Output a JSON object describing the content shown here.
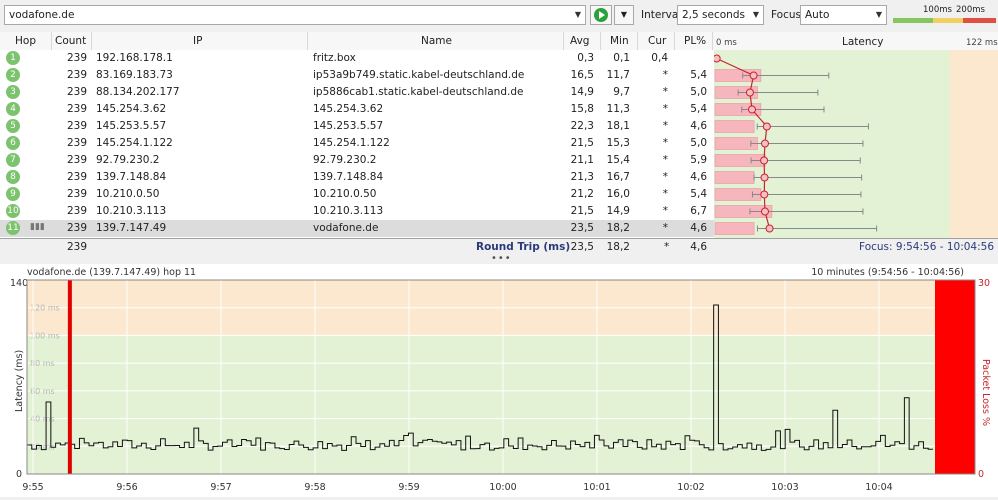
{
  "toolbar": {
    "target": "vodafone.de",
    "interval_label": "Interval",
    "interval_value": "2,5 seconds",
    "focus_label": "Focus",
    "focus_value": "Auto",
    "scale_labels": [
      "100ms",
      "200ms"
    ],
    "colors": {
      "green": "#86c65f",
      "yellow": "#f0d060",
      "red": "#e05040"
    }
  },
  "table": {
    "columns": [
      "Hop",
      "Count",
      "IP",
      "Name",
      "Avg",
      "Min",
      "Cur",
      "PL%"
    ],
    "latency_header": "Latency",
    "latency_min_label": "0 ms",
    "latency_max_label": "122 ms",
    "rows": [
      {
        "hop": "1",
        "count": "239",
        "ip": "192.168.178.1",
        "name": "fritz.box",
        "avg": "0,3",
        "min": "0,1",
        "cur": "0,4",
        "pl": ""
      },
      {
        "hop": "2",
        "count": "239",
        "ip": "83.169.183.73",
        "name": "ip53a9b749.static.kabel-deutschland.de",
        "avg": "16,5",
        "min": "11,7",
        "cur": "*",
        "pl": "5,4"
      },
      {
        "hop": "3",
        "count": "239",
        "ip": "88.134.202.177",
        "name": "ip5886cab1.static.kabel-deutschland.de",
        "avg": "14,9",
        "min": "9,7",
        "cur": "*",
        "pl": "5,0"
      },
      {
        "hop": "4",
        "count": "239",
        "ip": "145.254.3.62",
        "name": "145.254.3.62",
        "avg": "15,8",
        "min": "11,3",
        "cur": "*",
        "pl": "5,4"
      },
      {
        "hop": "5",
        "count": "239",
        "ip": "145.253.5.57",
        "name": "145.253.5.57",
        "avg": "22,3",
        "min": "18,1",
        "cur": "*",
        "pl": "4,6"
      },
      {
        "hop": "6",
        "count": "239",
        "ip": "145.254.1.122",
        "name": "145.254.1.122",
        "avg": "21,5",
        "min": "15,3",
        "cur": "*",
        "pl": "5,0"
      },
      {
        "hop": "7",
        "count": "239",
        "ip": "92.79.230.2",
        "name": "92.79.230.2",
        "avg": "21,1",
        "min": "15,4",
        "cur": "*",
        "pl": "5,9"
      },
      {
        "hop": "8",
        "count": "239",
        "ip": "139.7.148.84",
        "name": "139.7.148.84",
        "avg": "21,3",
        "min": "16,7",
        "cur": "*",
        "pl": "4,6"
      },
      {
        "hop": "9",
        "count": "239",
        "ip": "10.210.0.50",
        "name": "10.210.0.50",
        "avg": "21,2",
        "min": "16,0",
        "cur": "*",
        "pl": "5,4"
      },
      {
        "hop": "10",
        "count": "239",
        "ip": "10.210.3.113",
        "name": "10.210.3.113",
        "avg": "21,5",
        "min": "14,9",
        "cur": "*",
        "pl": "6,7"
      },
      {
        "hop": "11",
        "count": "239",
        "ip": "139.7.147.49",
        "name": "vodafone.de",
        "avg": "23,5",
        "min": "18,2",
        "cur": "*",
        "pl": "4,6"
      }
    ],
    "latency_max": [
      0,
      122,
      122,
      122,
      122,
      122,
      122,
      122,
      122,
      122,
      122
    ],
    "footer": {
      "count": "239",
      "label": "Round Trip (ms)",
      "avg": "23,5",
      "min": "18,2",
      "cur": "*",
      "pl": "4,6",
      "focus": "Focus: 9:54:56 - 10:04:56"
    }
  },
  "chart_data": {
    "type": "line",
    "title": "vodafone.de (139.7.147.49) hop 11",
    "range_label": "10 minutes (9:54:56 - 10:04:56)",
    "ylabel": "Latency (ms)",
    "y2label": "Packet Loss %",
    "ylim": [
      0,
      140
    ],
    "y_ticks": [
      "140",
      "0"
    ],
    "y_inner_ticks": [
      "120 ms",
      "100 ms",
      "80 ms",
      "60 ms",
      "40 ms",
      "20 ms"
    ],
    "y2_ticks": [
      "30",
      "0"
    ],
    "x_ticks": [
      "9:55",
      "9:56",
      "9:57",
      "9:58",
      "9:59",
      "10:00",
      "10:01",
      "10:02",
      "10:03",
      "10:04"
    ],
    "zones": [
      {
        "from": 0,
        "to": 100,
        "color": "#e3f2d5"
      },
      {
        "from": 100,
        "to": 140,
        "color": "#fbe8cf"
      }
    ],
    "spikes": [
      {
        "t": 0.02,
        "v": 52
      },
      {
        "t": 0.76,
        "v": 122
      },
      {
        "t": 0.89,
        "v": 46
      },
      {
        "t": 0.97,
        "v": 55
      }
    ],
    "packet_loss_markers": [
      {
        "t": 0.045,
        "pct": "single"
      },
      {
        "t": 1.0,
        "pct": "end"
      }
    ],
    "baseline_ms": 21
  }
}
